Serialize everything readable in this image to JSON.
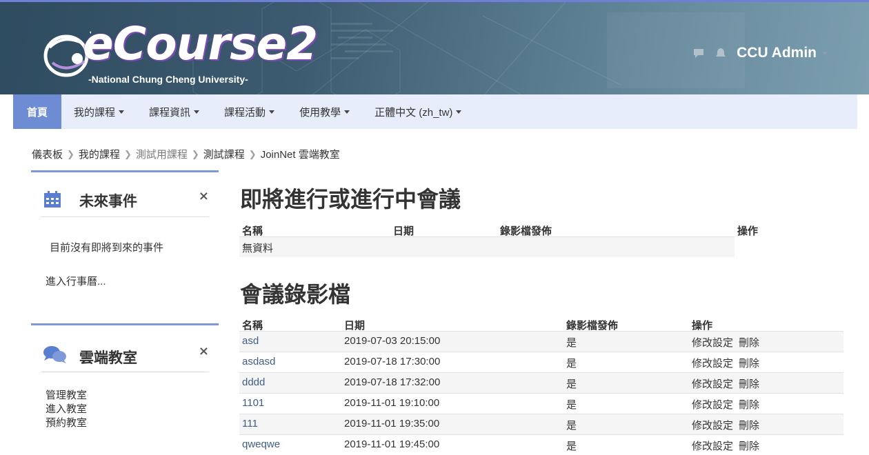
{
  "header": {
    "logo_title": "eCourse2",
    "logo_subtitle": "-National Chung Cheng University-",
    "user_name": "CCU Admin",
    "icons": [
      "message-icon",
      "notification-bell-icon",
      "user-caret-icon"
    ]
  },
  "navbar": {
    "items": [
      {
        "label": "首頁",
        "active": true
      },
      {
        "label": "我的課程",
        "dropdown": true
      },
      {
        "label": "課程資訊",
        "dropdown": true
      },
      {
        "label": "課程活動",
        "dropdown": true
      },
      {
        "label": "使用教學",
        "dropdown": true
      },
      {
        "label": "正體中文 (zh_tw)",
        "dropdown": true
      }
    ]
  },
  "breadcrumb": [
    "儀表板",
    "我的課程",
    "測試用課程",
    "測試課程",
    "JoinNet 雲端教室"
  ],
  "sidebar": {
    "events": {
      "title": "未來事件",
      "empty_text": "目前沒有即將到來的事件",
      "calendar_link": "進入行事曆...",
      "close": "×"
    },
    "classroom": {
      "title": "雲端教室",
      "close": "×",
      "links": [
        "管理教室",
        "進入教室",
        "預約教室"
      ]
    }
  },
  "upcoming": {
    "title": "即將進行或進行中會議",
    "columns": [
      "名稱",
      "日期",
      "錄影檔發佈",
      "操作"
    ],
    "empty": "無資料"
  },
  "recordings": {
    "title": "會議錄影檔",
    "columns": [
      "名稱",
      "日期",
      "錄影檔發佈",
      "操作"
    ],
    "edit_label": "修改設定",
    "delete_label": "刪除",
    "rows": [
      {
        "name": "asd",
        "date": "2019-07-03 20:15:00",
        "published": "是"
      },
      {
        "name": "asdasd",
        "date": "2019-07-18 17:30:00",
        "published": "是"
      },
      {
        "name": "dddd",
        "date": "2019-07-18 17:32:00",
        "published": "是"
      },
      {
        "name": "1101",
        "date": "2019-11-01 19:10:00",
        "published": "是"
      },
      {
        "name": "111",
        "date": "2019-11-01 19:35:00",
        "published": "是"
      },
      {
        "name": "qweqwe",
        "date": "2019-11-01 19:45:00",
        "published": "是"
      }
    ]
  },
  "colors": {
    "nav_active": "#6d8cd3",
    "navbar_bg": "#e7edfb",
    "block_top": "#7d97d9",
    "link": "#3f5c8a"
  }
}
